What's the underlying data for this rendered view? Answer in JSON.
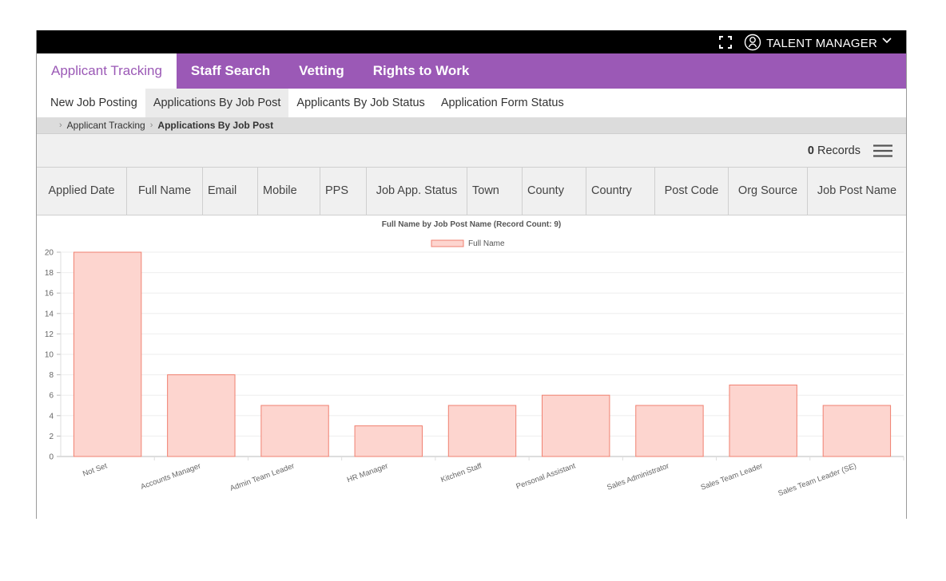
{
  "topbar": {
    "user_name": "TALENT MANAGER",
    "icons": [
      "fullscreen-icon",
      "user-icon",
      "chevron-down-icon"
    ]
  },
  "main_nav": [
    {
      "label": "Applicant Tracking",
      "active": true
    },
    {
      "label": "Staff Search",
      "active": false
    },
    {
      "label": "Vetting",
      "active": false
    },
    {
      "label": "Rights to Work",
      "active": false
    }
  ],
  "sub_nav": [
    {
      "label": "New Job Posting",
      "active": false
    },
    {
      "label": "Applications By Job Post",
      "active": true
    },
    {
      "label": "Applicants By Job Status",
      "active": false
    },
    {
      "label": "Application Form Status",
      "active": false
    }
  ],
  "breadcrumb": {
    "parent": "Applicant Tracking",
    "current": "Applications By Job Post"
  },
  "records": {
    "count": "0",
    "label": "Records"
  },
  "table_headers": [
    "Applied Date",
    "Full Name",
    "Email",
    "Mobile",
    "PPS",
    "Job App. Status",
    "Town",
    "County",
    "Country",
    "Post Code",
    "Org Source",
    "Job Post Name"
  ],
  "colors": {
    "brand_purple": "#9b59b6",
    "bar_fill": "#fdd5cf",
    "bar_stroke": "#f08070"
  },
  "chart_data": {
    "type": "bar",
    "title": "Full Name by Job Post Name (Record Count: 9)",
    "legend_position": "top-center",
    "grid": true,
    "categories": [
      "Not Set",
      "Accounts Manager",
      "Admin Team Leader",
      "HR Manager",
      "Kitchen Staff",
      "Personal Assistant",
      "Sales Administrator",
      "Sales Team Leader",
      "Sales Team Leader (SE)"
    ],
    "series": [
      {
        "name": "Full Name",
        "values": [
          20,
          8,
          5,
          3,
          5,
          6,
          5,
          7,
          5
        ]
      }
    ],
    "ylim": [
      0,
      20
    ],
    "yticks": [
      0,
      2,
      4,
      6,
      8,
      10,
      12,
      14,
      16,
      18,
      20
    ],
    "xlabel": "",
    "ylabel": ""
  }
}
